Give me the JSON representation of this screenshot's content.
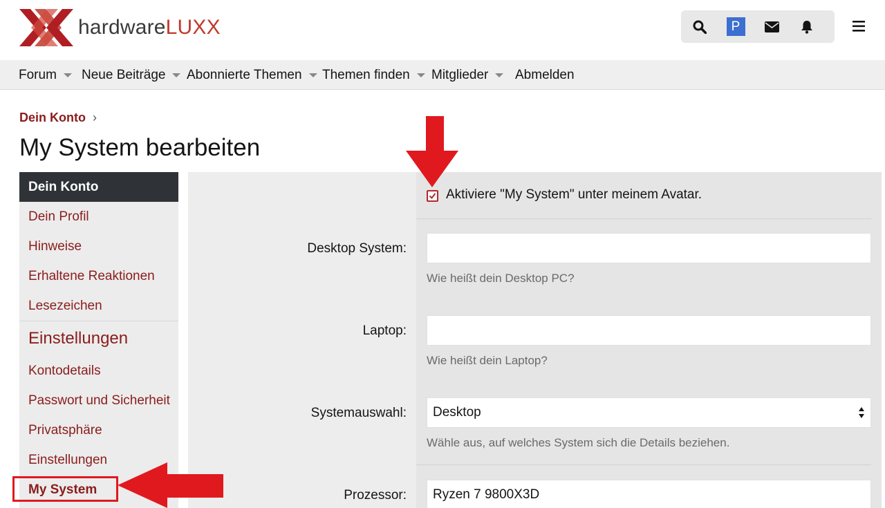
{
  "brand": {
    "text_main": "hardware",
    "text_accent": "LUXX",
    "accent_color": "#c0392b",
    "mark_color": "#b01e23"
  },
  "header": {
    "icons": [
      "search-icon",
      "avatar",
      "envelope-icon",
      "bell-icon"
    ],
    "avatar_letter": "P",
    "avatar_color": "#3d6fd1",
    "menu_icon": "hamburger-icon"
  },
  "nav": {
    "items": [
      {
        "label": "Forum",
        "has_caret": true
      },
      {
        "label": "Neue Beiträge",
        "has_caret": true
      },
      {
        "label": "Abonnierte Themen",
        "has_caret": true
      },
      {
        "label": "Themen finden",
        "has_caret": true
      },
      {
        "label": "Mitglieder",
        "has_caret": true
      },
      {
        "label": "Abmelden",
        "has_caret": false
      }
    ]
  },
  "breadcrumb": {
    "label": "Dein Konto",
    "separator": "›"
  },
  "page": {
    "title": "My System bearbeiten"
  },
  "sidebar": {
    "header": "Dein Konto",
    "items": [
      "Dein Profil",
      "Hinweise",
      "Erhaltene Reaktionen",
      "Lesezeichen"
    ],
    "section": "Einstellungen",
    "settings_items": [
      "Kontodetails",
      "Passwort und Sicherheit",
      "Privatsphäre",
      "Einstellungen",
      "My System"
    ],
    "active": "My System",
    "link_color": "#8b1c1c"
  },
  "form": {
    "enable_checkbox": {
      "label": "Aktiviere \"My System\" unter meinem Avatar.",
      "checked": true
    },
    "desktop": {
      "label": "Desktop System:",
      "value": "",
      "hint": "Wie heißt dein Desktop PC?"
    },
    "laptop": {
      "label": "Laptop:",
      "value": "",
      "hint": "Wie heißt dein Laptop?"
    },
    "system_select": {
      "label": "Systemauswahl:",
      "value": "Desktop",
      "hint": "Wähle aus, auf welches System sich die Details beziehen."
    },
    "processor": {
      "label": "Prozessor:",
      "value": "Ryzen 7 9800X3D"
    }
  },
  "annotations": {
    "arrow_color": "#e0191f"
  }
}
